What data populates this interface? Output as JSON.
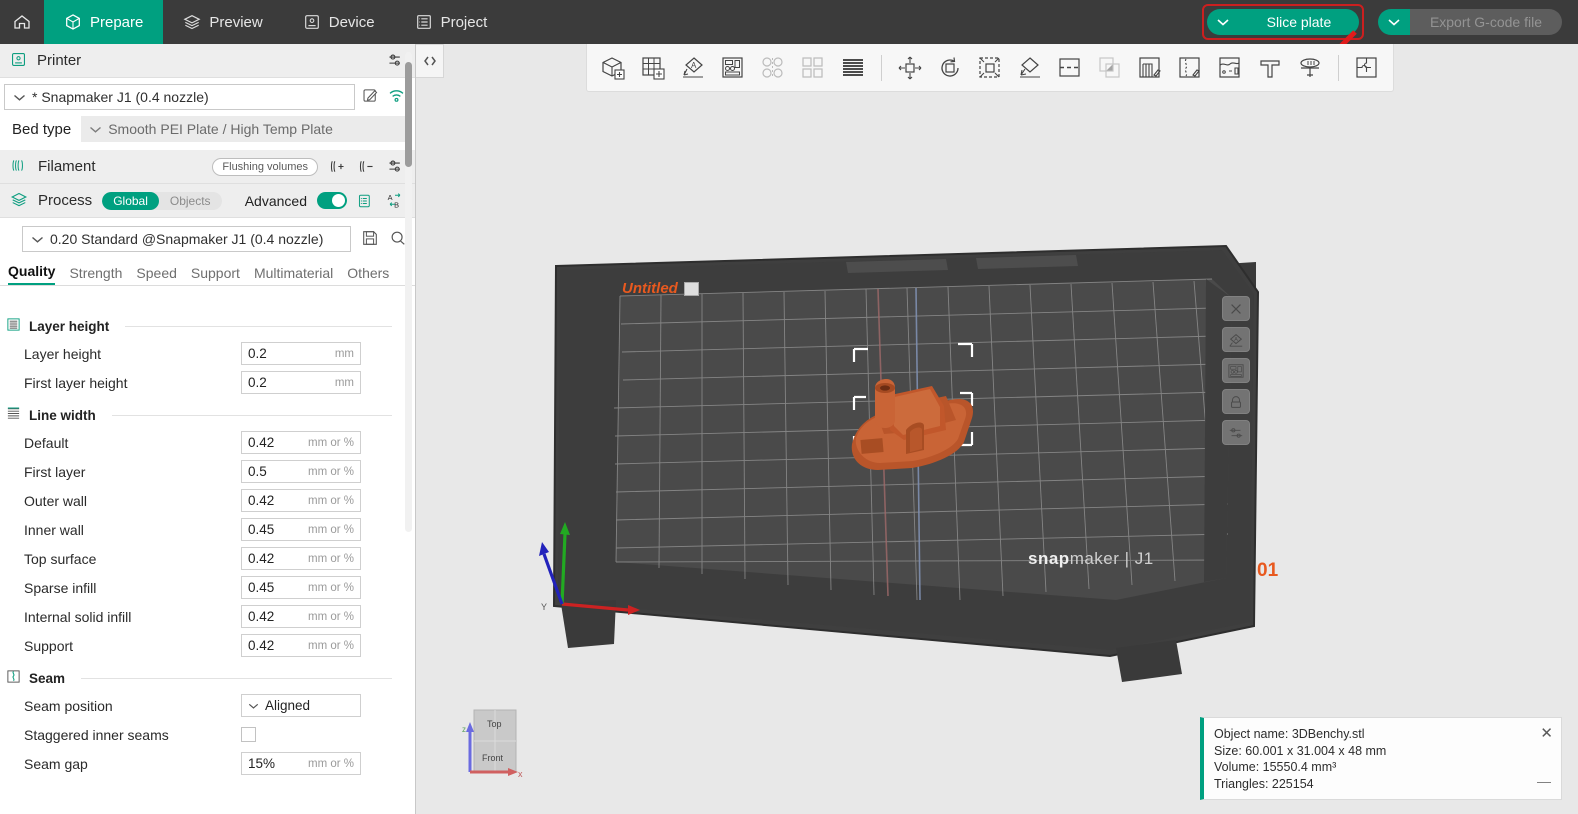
{
  "topbar": {
    "home_icon": "home-icon",
    "nav": [
      {
        "label": "Prepare",
        "icon": "cube-hex-icon",
        "active": true
      },
      {
        "label": "Preview",
        "icon": "layers-icon",
        "active": false
      },
      {
        "label": "Device",
        "icon": "printer-icon",
        "active": false
      },
      {
        "label": "Project",
        "icon": "list-icon",
        "active": false
      }
    ],
    "slice_button": {
      "label": "Slice plate",
      "caret": "chevron-down-icon",
      "highlighted": true
    },
    "export_button": {
      "label": "Export G-code file",
      "caret": "chevron-down-icon",
      "disabled": true
    }
  },
  "left_panel": {
    "printer": {
      "section_label": "Printer",
      "section_icon": "printer-icon",
      "settings_icon": "sliders-icon",
      "preset": "* Snapmaker J1 (0.4 nozzle)",
      "edit_icon": "edit-pencil-icon",
      "wifi_icon": "wifi-icon",
      "bed_type_label": "Bed type",
      "bed_type_value": "Smooth PEI Plate / High Temp Plate"
    },
    "filament": {
      "section_label": "Filament",
      "section_icon": "filament-spool-icon",
      "flushing_label": "Flushing volumes",
      "add_icon": "filament-add-icon",
      "remove_icon": "filament-remove-icon",
      "settings_icon": "sliders-icon"
    },
    "process": {
      "section_label": "Process",
      "section_icon": "layers-icon",
      "scope_options": [
        "Global",
        "Objects"
      ],
      "scope_selected": "Global",
      "advanced_label": "Advanced",
      "advanced_on": true,
      "list_icon": "settings-list-icon",
      "compare_icon": "compare-ab-icon",
      "preset": "0.20 Standard @Snapmaker J1 (0.4 nozzle)",
      "save_icon": "save-icon",
      "search_icon": "search-icon"
    },
    "tabs": [
      {
        "label": "Quality",
        "active": true
      },
      {
        "label": "Strength",
        "active": false
      },
      {
        "label": "Speed",
        "active": false
      },
      {
        "label": "Support",
        "active": false
      },
      {
        "label": "Multimaterial",
        "active": false
      },
      {
        "label": "Others",
        "active": false
      }
    ],
    "groups": [
      {
        "title": "Layer height",
        "icon": "layer-height-icon",
        "rows": [
          {
            "label": "Layer height",
            "type": "value",
            "value": "0.2",
            "unit": "mm"
          },
          {
            "label": "First layer height",
            "type": "value",
            "value": "0.2",
            "unit": "mm"
          }
        ]
      },
      {
        "title": "Line width",
        "icon": "line-width-icon",
        "rows": [
          {
            "label": "Default",
            "type": "value",
            "value": "0.42",
            "unit": "mm or %"
          },
          {
            "label": "First layer",
            "type": "value",
            "value": "0.5",
            "unit": "mm or %"
          },
          {
            "label": "Outer wall",
            "type": "value",
            "value": "0.42",
            "unit": "mm or %"
          },
          {
            "label": "Inner wall",
            "type": "value",
            "value": "0.45",
            "unit": "mm or %"
          },
          {
            "label": "Top surface",
            "type": "value",
            "value": "0.42",
            "unit": "mm or %"
          },
          {
            "label": "Sparse infill",
            "type": "value",
            "value": "0.45",
            "unit": "mm or %"
          },
          {
            "label": "Internal solid infill",
            "type": "value",
            "value": "0.42",
            "unit": "mm or %"
          },
          {
            "label": "Support",
            "type": "value",
            "value": "0.42",
            "unit": "mm or %"
          }
        ]
      },
      {
        "title": "Seam",
        "icon": "seam-icon",
        "rows": [
          {
            "label": "Seam position",
            "type": "select",
            "value": "Aligned",
            "unit": ""
          },
          {
            "label": "Staggered inner seams",
            "type": "checkbox",
            "value": "",
            "unit": ""
          },
          {
            "label": "Seam gap",
            "type": "value",
            "value": "15%",
            "unit": "mm or %"
          }
        ]
      }
    ]
  },
  "viewport": {
    "collapse_icon": "collapse-chevrons-icon",
    "toolbar": [
      {
        "name": "add-object-icon",
        "dim": false
      },
      {
        "name": "add-plate-icon",
        "dim": false
      },
      {
        "name": "auto-orient-icon",
        "dim": false
      },
      {
        "name": "arrange-icon",
        "dim": false
      },
      {
        "name": "split-to-objects-icon",
        "dim": true
      },
      {
        "name": "split-to-parts-icon",
        "dim": true
      },
      {
        "name": "layers-variable-icon",
        "dim": false
      },
      {
        "name": "separator",
        "dim": false
      },
      {
        "name": "move-icon",
        "dim": false
      },
      {
        "name": "rotate-icon",
        "dim": false
      },
      {
        "name": "scale-icon",
        "dim": false
      },
      {
        "name": "place-on-face-icon",
        "dim": false
      },
      {
        "name": "cut-icon",
        "dim": false
      },
      {
        "name": "mesh-boolean-icon",
        "dim": true
      },
      {
        "name": "support-painting-icon",
        "dim": false
      },
      {
        "name": "seam-painting-icon",
        "dim": false
      },
      {
        "name": "color-painting-icon",
        "dim": false
      },
      {
        "name": "text-shape-icon",
        "dim": false
      },
      {
        "name": "assembly-view-icon",
        "dim": false
      },
      {
        "name": "separator2",
        "dim": false
      },
      {
        "name": "puzzle-icon",
        "dim": false
      }
    ],
    "side_tools": [
      {
        "name": "delete-icon"
      },
      {
        "name": "auto-orient-icon"
      },
      {
        "name": "arrange-icon"
      },
      {
        "name": "lock-icon"
      },
      {
        "name": "plate-settings-icon"
      }
    ],
    "plate_label": "Untitled",
    "plate_edit_icon": "edit-plate-icon",
    "plate_number": "01",
    "bed_logo_bold": "snap",
    "bed_logo_light": "maker | J1",
    "viewcube": {
      "top_label": "Top",
      "front_label": "Front",
      "x_axis": "x",
      "z_axis": "z"
    },
    "axes": {
      "x": "X",
      "y": "Y",
      "z": "Z"
    },
    "object_panel": {
      "object_name": "Object name: 3DBenchy.stl",
      "size": "Size: 60.001 x 31.004 x 48 mm",
      "volume": "Volume: 15550.4 mm³",
      "triangles": "Triangles: 225154",
      "close_icon": "close-icon",
      "minimize_icon": "minimize-icon"
    }
  },
  "colors": {
    "accent": "#00a080",
    "topbar_bg": "#3b3b3b",
    "highlight_border": "#cc1f1f",
    "model_orange": "#c35a2a",
    "plate_orange": "#e8591f"
  }
}
